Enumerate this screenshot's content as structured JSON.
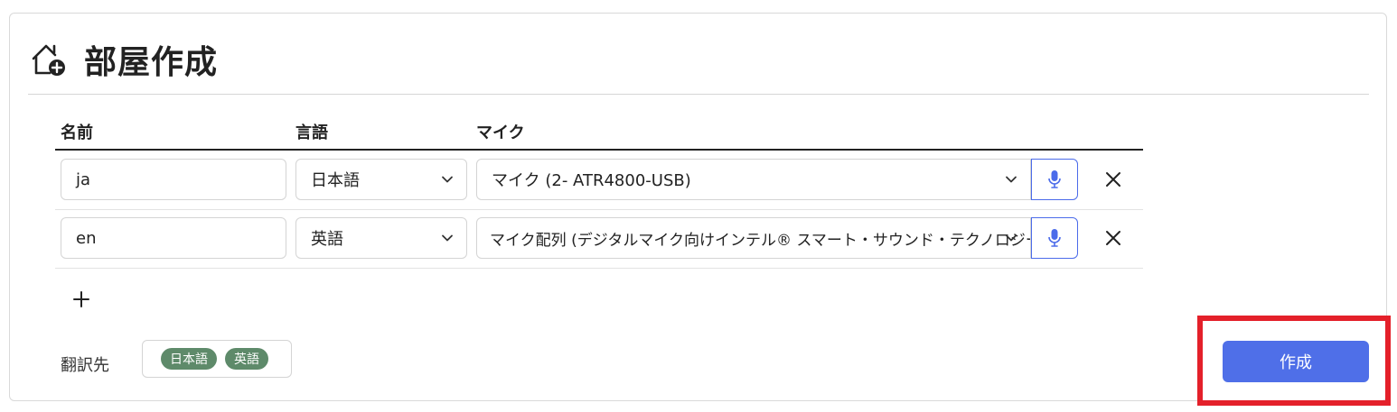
{
  "header": {
    "title": "部屋作成",
    "icon": "home-add-icon"
  },
  "table": {
    "columns": {
      "name": "名前",
      "language": "言語",
      "mic": "マイク"
    },
    "rows": [
      {
        "name": "ja",
        "language": "日本語",
        "mic": "マイク (2- ATR4800-USB)"
      },
      {
        "name": "en",
        "language": "英語",
        "mic": "マイク配列 (デジタルマイク向けインテル® スマート・サウンド・テクノロジー)"
      }
    ]
  },
  "add_icon": "plus-icon",
  "translation": {
    "label": "翻訳先",
    "chips": [
      "日本語",
      "英語"
    ]
  },
  "actions": {
    "create_label": "作成"
  },
  "colors": {
    "primary": "#4f6fe8",
    "chip": "#5e8a6a",
    "highlight": "#e4202a",
    "mic_border": "#4b6bea"
  }
}
